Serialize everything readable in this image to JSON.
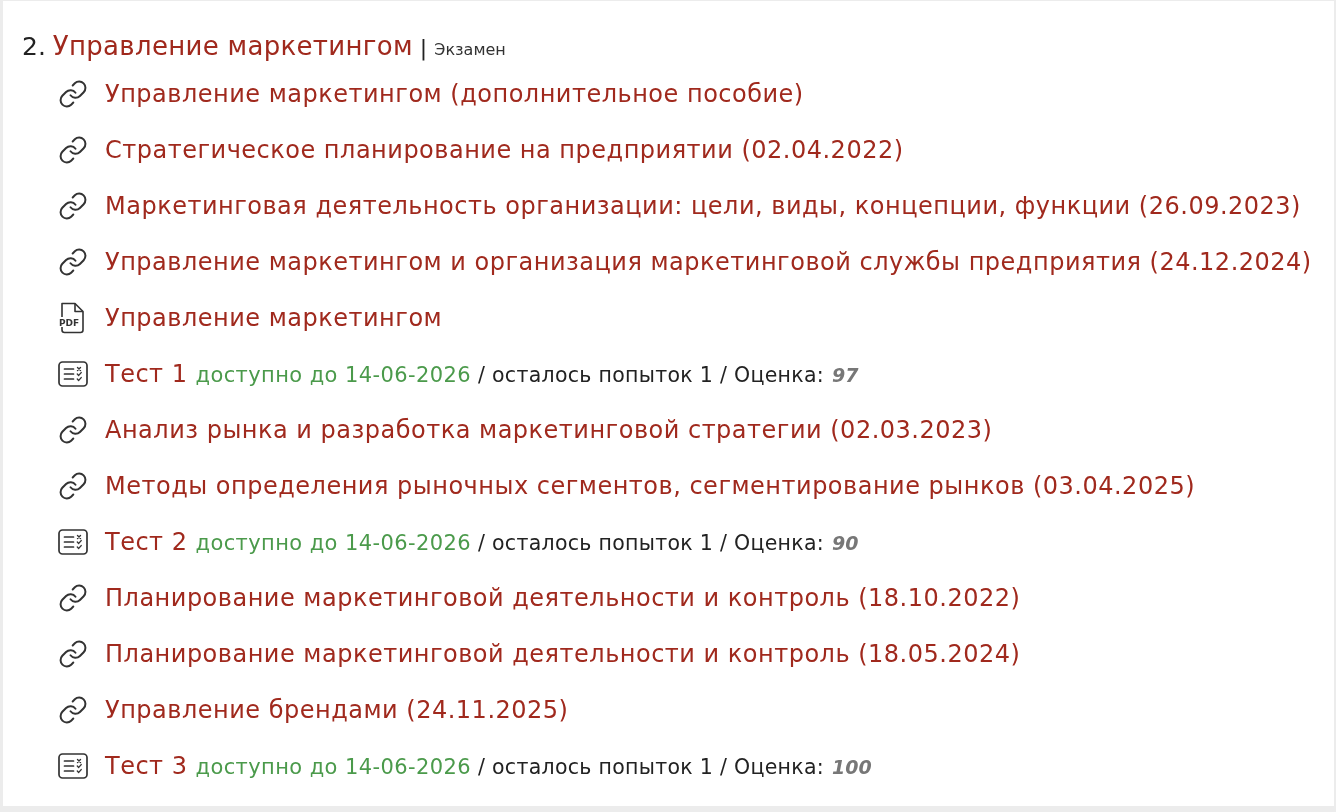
{
  "section": {
    "number": "2.",
    "title": "Управление маркетингом",
    "separator": "|",
    "assessment": "Экзамен"
  },
  "items": [
    {
      "kind": "link",
      "title": "Управление маркетингом (дополнительное пособие)"
    },
    {
      "kind": "link",
      "title": "Стратегическое планирование на предприятии (02.04.2022)"
    },
    {
      "kind": "link",
      "title": "Маркетинговая деятельность организации: цели, виды, концепции, функции (26.09.2023)"
    },
    {
      "kind": "link",
      "title": "Управление маркетингом и организация маркетинговой службы предприятия (24.12.2024)"
    },
    {
      "kind": "pdf",
      "icon_label": "PDF",
      "title": "Управление маркетингом"
    },
    {
      "kind": "test",
      "title": "Тест 1",
      "availability": "доступно до 14-06-2026",
      "attempts": "/ осталось попыток 1 / Оценка:",
      "grade": "97"
    },
    {
      "kind": "link",
      "title": "Анализ рынка и разработка маркетинговой стратегии (02.03.2023)"
    },
    {
      "kind": "link",
      "title": "Методы определения рыночных сегментов, сегментирование рынков (03.04.2025)"
    },
    {
      "kind": "test",
      "title": "Тест 2",
      "availability": "доступно до 14-06-2026",
      "attempts": "/ осталось попыток 1 / Оценка:",
      "grade": "90"
    },
    {
      "kind": "link",
      "title": "Планирование маркетинговой деятельности и контроль (18.10.2022)"
    },
    {
      "kind": "link",
      "title": "Планирование маркетинговой деятельности и контроль (18.05.2024)"
    },
    {
      "kind": "link",
      "title": "Управление брендами (24.11.2025)"
    },
    {
      "kind": "test",
      "title": "Тест 3",
      "availability": "доступно до 14-06-2026",
      "attempts": "/ осталось попыток 1 / Оценка:",
      "grade": "100"
    }
  ]
}
